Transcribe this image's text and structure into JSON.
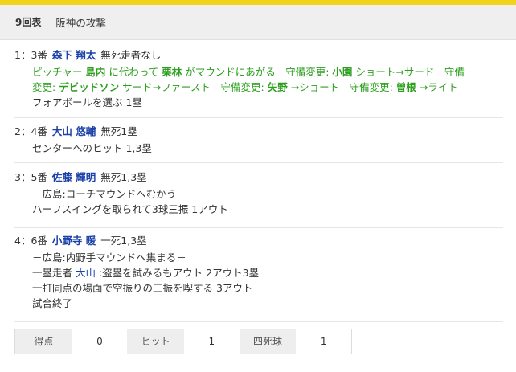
{
  "header": {
    "inning": "9回表",
    "attack": "阪神の攻撃"
  },
  "plays": [
    {
      "no": "1：3番",
      "batter": "森下 翔太",
      "situation": "無死走者なし",
      "green_lines": [
        [
          {
            "t": "ピッチャー "
          },
          {
            "t": "島内",
            "b": true
          },
          {
            "t": " に代わって "
          },
          {
            "t": "栗林",
            "b": true
          },
          {
            "t": " がマウンドにあがる　守備変更: "
          },
          {
            "t": "小園",
            "b": true
          },
          {
            "t": " ショート→サード　守備"
          }
        ],
        [
          {
            "t": "変更: "
          },
          {
            "t": "デビッドソン",
            "b": true
          },
          {
            "t": " サード→ファースト　守備変更: "
          },
          {
            "t": "矢野",
            "b": true
          },
          {
            "t": " →ショート　守備変更: "
          },
          {
            "t": "曽根",
            "b": true
          },
          {
            "t": " →ライト"
          }
        ]
      ],
      "result": "フォアボールを選ぶ 1塁"
    },
    {
      "no": "2：4番",
      "batter": "大山 悠輔",
      "situation": "無死1塁",
      "result": "センターへのヒット 1,3塁"
    },
    {
      "no": "3：5番",
      "batter": "佐藤 輝明",
      "situation": "無死1,3塁",
      "note": "－広島:コーチマウンドへむかう－",
      "result": "ハーフスイングを取られて3球三振 1アウト"
    },
    {
      "no": "4：6番",
      "batter": "小野寺 暖",
      "situation": "一死1,3塁",
      "note": "－広島:内野手マウンドへ集まる－",
      "steal_prefix": "一塁走者 ",
      "steal_runner": "大山",
      "steal_suffix": " :盗塁を試みるもアウト 2アウト3塁",
      "result": "一打同点の場面で空振りの三振を喫する 3アウト",
      "end": "試合終了"
    }
  ],
  "stats": {
    "runs_label": "得点",
    "runs": "0",
    "hits_label": "ヒット",
    "hits": "1",
    "walks_label": "四死球",
    "walks": "1"
  }
}
